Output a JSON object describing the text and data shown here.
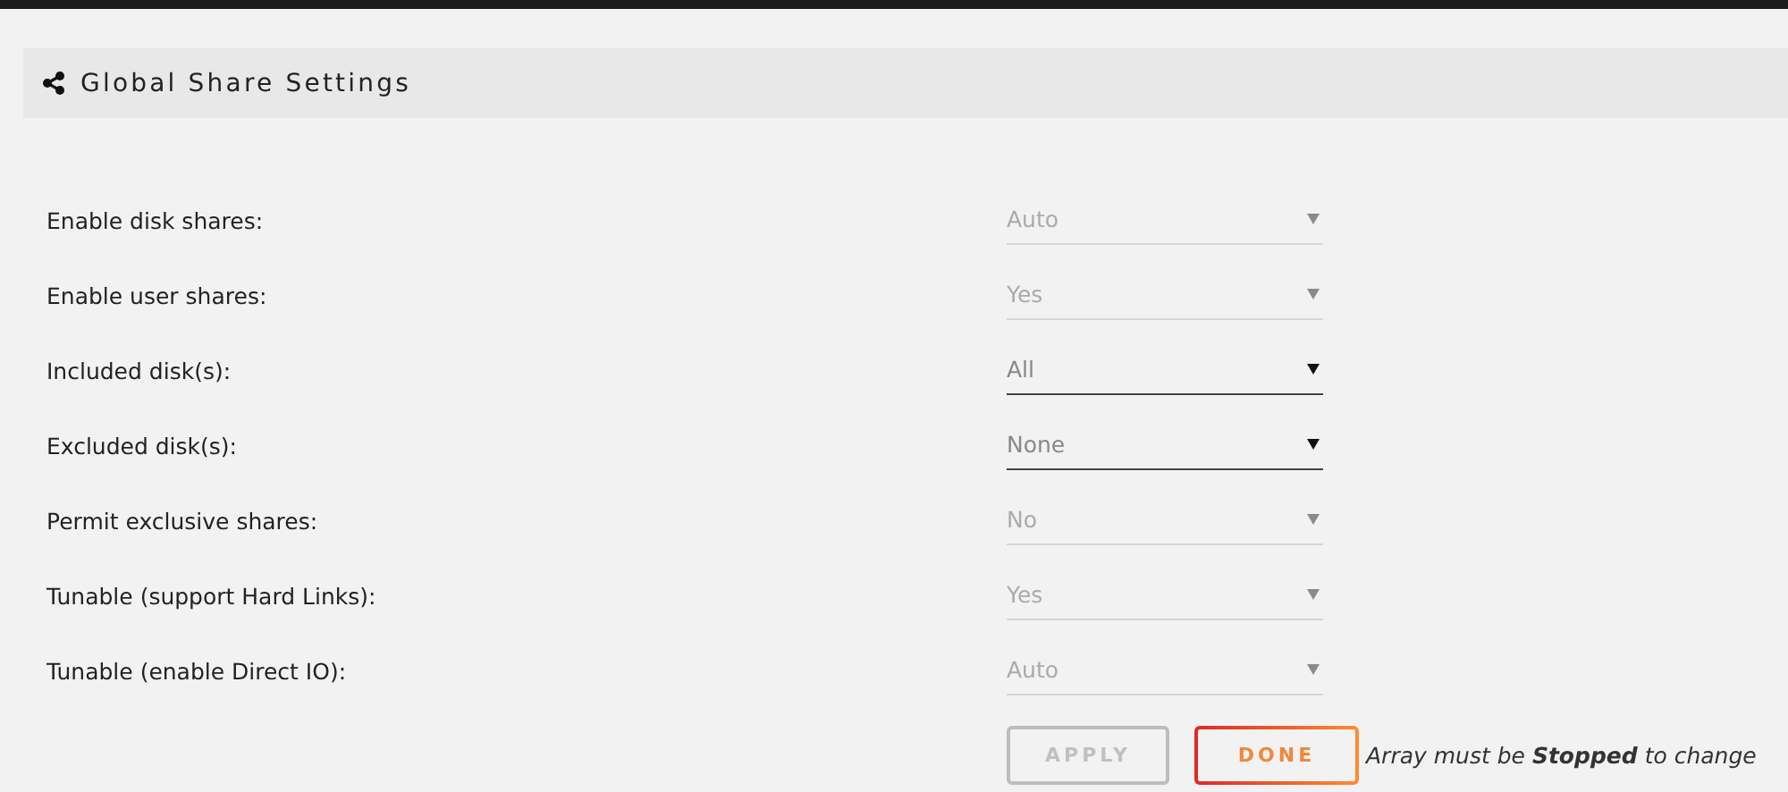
{
  "header": {
    "title": "Global Share Settings"
  },
  "settings": [
    {
      "label": "Enable disk shares:",
      "value": "Auto",
      "disabled": true
    },
    {
      "label": "Enable user shares:",
      "value": "Yes",
      "disabled": true
    },
    {
      "label": "Included disk(s):",
      "value": "All",
      "disabled": false
    },
    {
      "label": "Excluded disk(s):",
      "value": "None",
      "disabled": false
    },
    {
      "label": "Permit exclusive shares:",
      "value": "No",
      "disabled": true
    },
    {
      "label": "Tunable (support Hard Links):",
      "value": "Yes",
      "disabled": true
    },
    {
      "label": "Tunable (enable Direct IO):",
      "value": "Auto",
      "disabled": true
    }
  ],
  "buttons": [
    {
      "label": "APPLY",
      "disabled": true
    },
    {
      "label": "DONE",
      "disabled": false
    }
  ],
  "note": "Array must be **Stopped** to change"
}
